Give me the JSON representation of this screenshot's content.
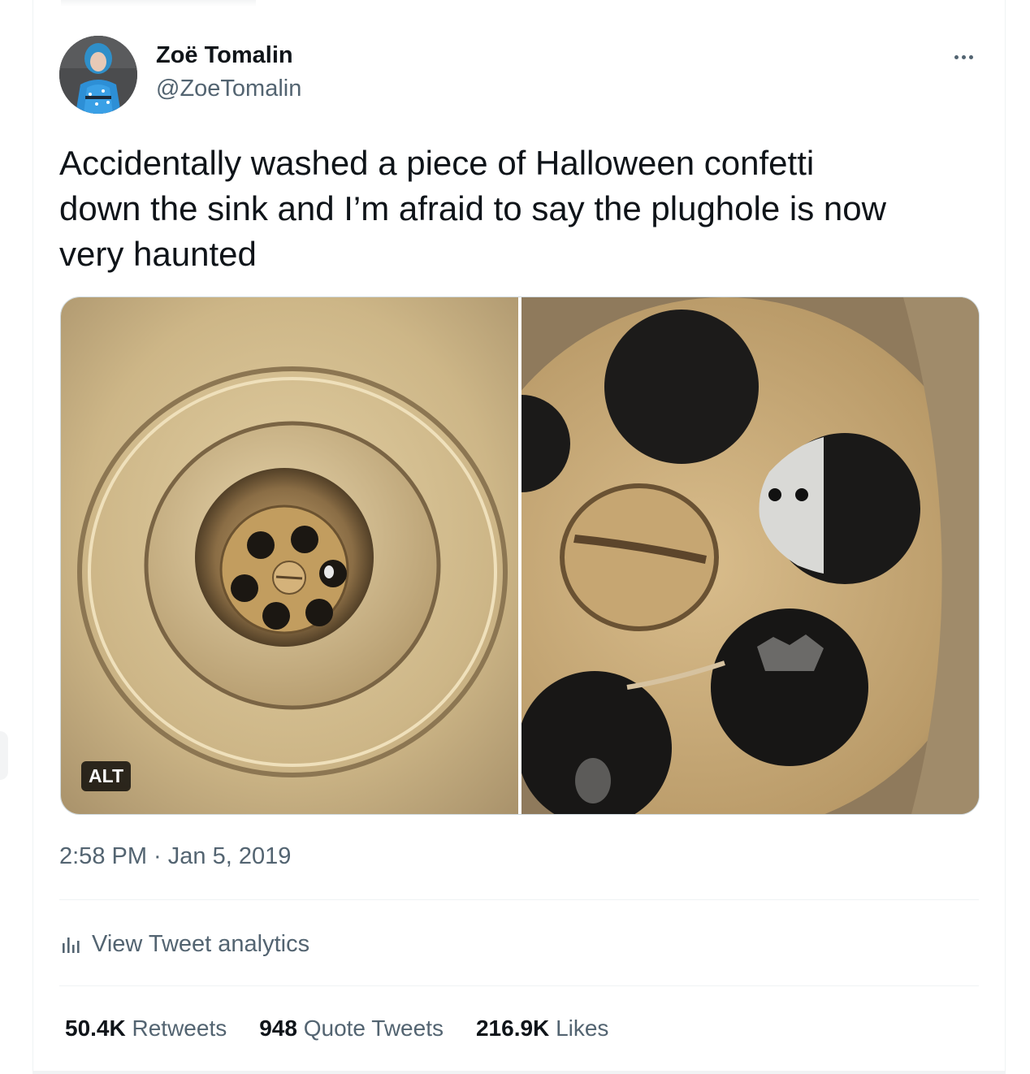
{
  "tweet": {
    "author_name": "Zoë Tomalin",
    "author_handle": "@ZoeTomalin",
    "text": "Accidentally washed a piece of Halloween confetti\ndown the sink and I’m afraid to say the plughole is now\nvery haunted",
    "media_alt_badge": "ALT",
    "timestamp": "2:58 PM · Jan 5, 2019",
    "analytics_label": "View Tweet analytics"
  },
  "stats": {
    "retweets_count": "50.4K",
    "retweets_label": "Retweets",
    "quotes_count": "948",
    "quotes_label": "Quote Tweets",
    "likes_count": "216.9K",
    "likes_label": "Likes"
  },
  "colors": {
    "text_primary": "#0f1419",
    "text_secondary": "#536471",
    "divider": "#eff3f4",
    "media_border": "#cfd9de"
  },
  "icons": [
    "more-options-icon",
    "analytics-bar-icon"
  ]
}
